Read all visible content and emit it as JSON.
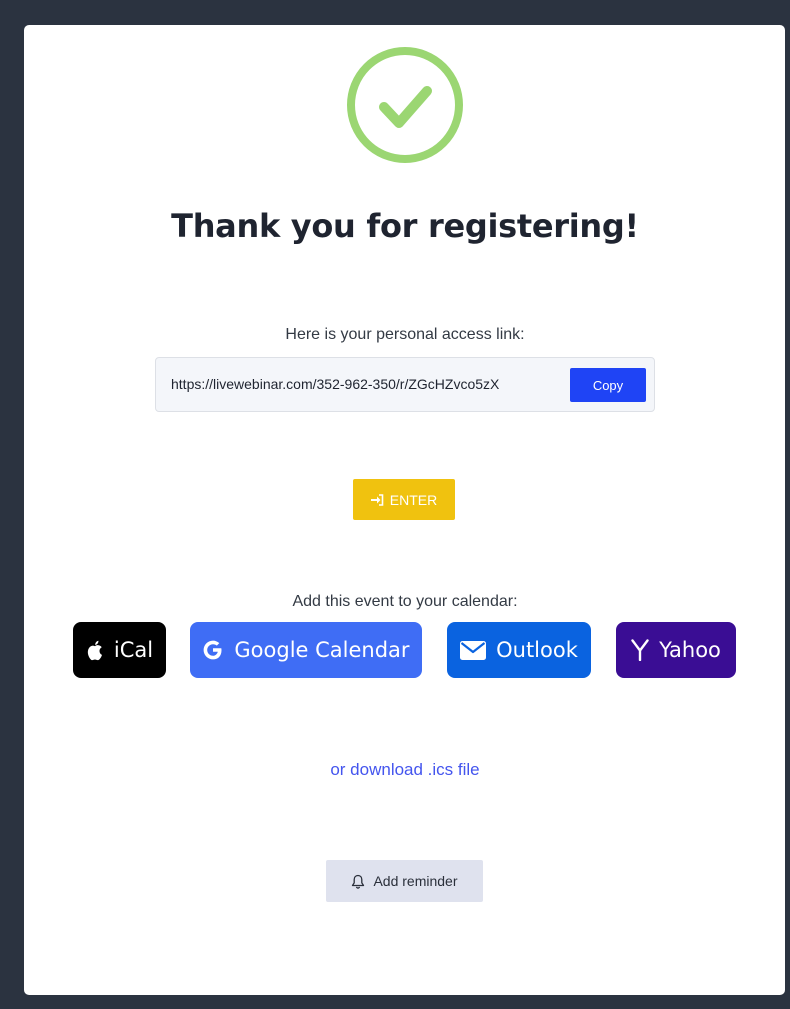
{
  "header": {
    "title": "Thank you for registering!"
  },
  "access": {
    "label": "Here is your personal access link:",
    "link": "https://livewebinar.com/352-962-350/r/ZGcHZvco5zX",
    "copy_label": "Copy"
  },
  "enter": {
    "label": "ENTER"
  },
  "calendar": {
    "label": "Add this event to your calendar:",
    "ical_label": "iCal",
    "google_label": "Google Calendar",
    "outlook_label": "Outlook",
    "yahoo_label": "Yahoo",
    "ics_label": "or download .ics file"
  },
  "reminder": {
    "label": "Add reminder"
  },
  "colors": {
    "success": "#9bd672",
    "copy": "#1f44f5",
    "enter": "#f0c20f",
    "ical": "#000000",
    "google": "#3f6df5",
    "outlook": "#0a63e0",
    "yahoo": "#3a0d94",
    "link": "#4455ee"
  },
  "icons": {
    "success": "check-circle-icon",
    "enter": "sign-in-icon",
    "ical": "apple-icon",
    "google": "google-icon",
    "outlook": "envelope-icon",
    "yahoo": "yahoo-icon",
    "reminder": "bell-icon"
  }
}
